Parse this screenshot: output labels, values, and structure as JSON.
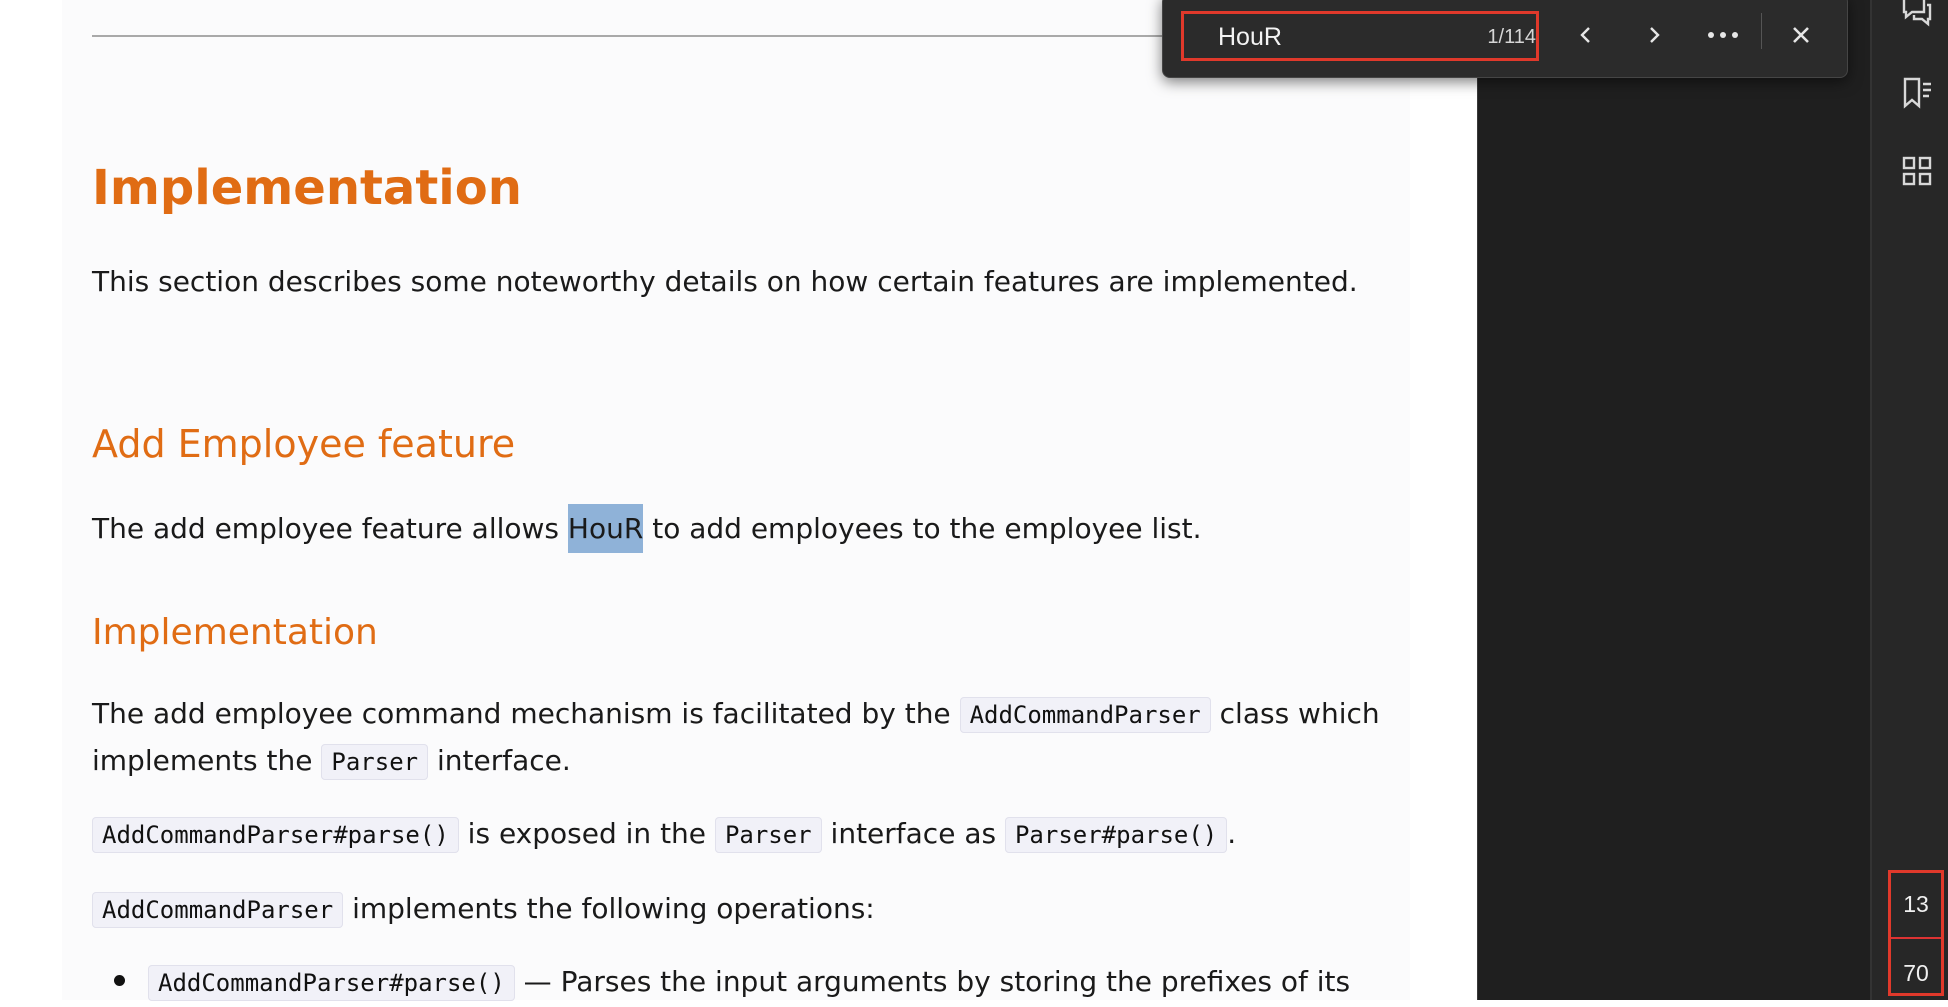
{
  "document": {
    "heading_implementation": "Implementation",
    "intro": "This section describes some noteworthy details on how certain features are implemented.",
    "heading_add_employee": "Add Employee feature",
    "add_employee_before": "The add employee feature allows ",
    "add_employee_match": "HouR",
    "add_employee_after": " to add employees to the employee list.",
    "subheading_implementation": "Implementation",
    "p1_before": "The add employee command mechanism is facilitated by the ",
    "p1_code": "AddCommandParser",
    "p1_after": " class which",
    "p1_line2_before": "implements the ",
    "p1_line2_code": "Parser",
    "p1_line2_after": " interface.",
    "p2_code1": "AddCommandParser#parse()",
    "p2_mid1": " is exposed in the ",
    "p2_code2": "Parser",
    "p2_mid2": " interface as ",
    "p2_code3": "Parser#parse()",
    "p2_end": ".",
    "p3_code": "AddCommandParser",
    "p3_text": " implements the following operations:",
    "li1_code": "AddCommandParser#parse()",
    "li1_text": " — Parses the input arguments by storing the prefixes of its"
  },
  "find": {
    "query": "HouR",
    "count": "1/114"
  },
  "page_indicator": {
    "current": "13",
    "total": "70"
  }
}
